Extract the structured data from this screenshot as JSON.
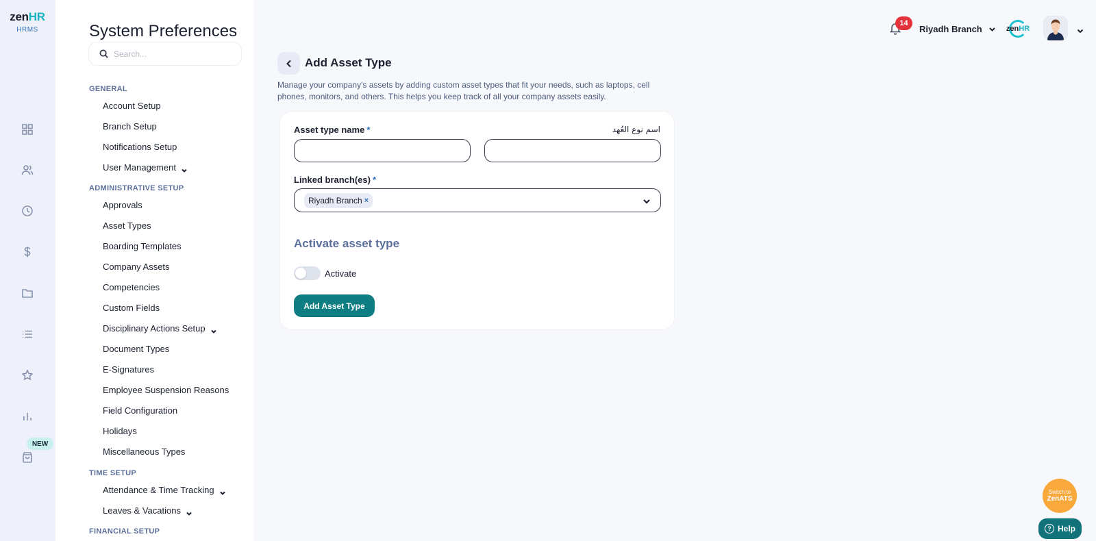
{
  "brand": {
    "logo_zen": "zen",
    "logo_hr": "HR",
    "logo_sub": "HRMS"
  },
  "rail": {
    "new_badge": "NEW",
    "icons": [
      "dashboard-icon",
      "people-icon",
      "clock-icon",
      "dollar-icon",
      "folder-icon",
      "list-icon",
      "star-icon",
      "bar-chart-icon",
      "shopping-bag-icon"
    ]
  },
  "sidebar": {
    "title": "System Preferences",
    "search_placeholder": "Search...",
    "sections": {
      "general": "GENERAL",
      "administrative": "ADMINISTRATIVE SETUP",
      "time": "TIME SETUP",
      "financial": "FINANCIAL SETUP"
    },
    "items": {
      "account_setup": "Account Setup",
      "branch_setup": "Branch Setup",
      "notifications_setup": "Notifications Setup",
      "user_management": "User Management",
      "approvals": "Approvals",
      "asset_types": "Asset Types",
      "boarding_templates": "Boarding Templates",
      "company_assets": "Company Assets",
      "competencies": "Competencies",
      "custom_fields": "Custom Fields",
      "disciplinary": "Disciplinary Actions Setup",
      "document_types": "Document Types",
      "e_signatures": "E-Signatures",
      "suspension_reasons": "Employee Suspension Reasons",
      "field_configuration": "Field Configuration",
      "holidays": "Holidays",
      "misc_types": "Miscellaneous Types",
      "attendance": "Attendance & Time Tracking",
      "leaves": "Leaves & Vacations"
    }
  },
  "topbar": {
    "notification_count": "14",
    "branch": "Riyadh Branch",
    "mini_logo_zen": "zen",
    "mini_logo_hr": "HR"
  },
  "main": {
    "title": "Add Asset Type",
    "description": "Manage your company's assets by adding custom asset types that fit your needs, such as laptops, cell phones, monitors, and others. This helps you keep track of all your company assets easily.",
    "form": {
      "name_label": "Asset type name",
      "required_mark": "*",
      "name_label_ar": "اسم نوع العُهد",
      "name_value": "",
      "name_ar_value": "",
      "branches_label": "Linked branch(es)",
      "branch_chip": "Riyadh Branch",
      "chip_remove": "×",
      "activate_heading": "Activate asset type",
      "activate_label": "Activate",
      "activate_on": false,
      "submit_label": "Add Asset Type"
    }
  },
  "floating": {
    "ats_line1": "Switch to",
    "ats_line2": "ZenATS",
    "help_label": "Help",
    "help_icon": "?"
  },
  "colors": {
    "primary": "#0f7e82",
    "accent": "#18b4c2",
    "badge": "#e5323b",
    "ats": "#f9a83b",
    "section": "#5b6f9a"
  }
}
